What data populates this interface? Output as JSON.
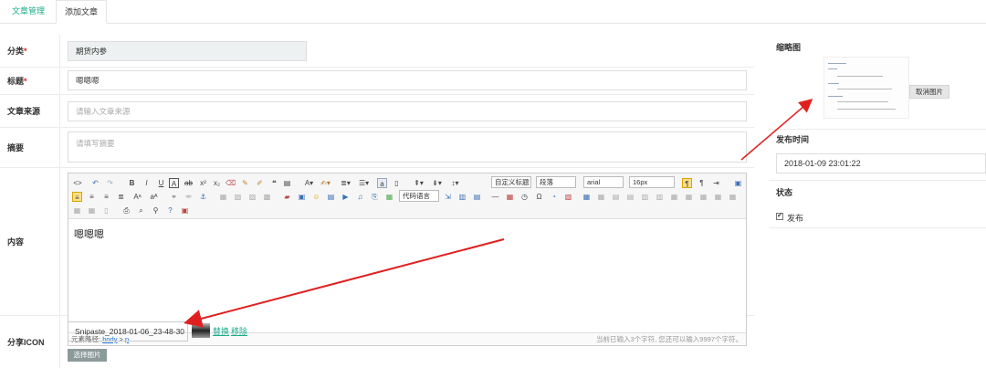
{
  "tabs": [
    {
      "label": "文章管理"
    },
    {
      "label": "添加文章"
    }
  ],
  "form": {
    "category": {
      "label": "分类",
      "required_mark": "*",
      "value": "期货内参"
    },
    "title": {
      "label": "标题",
      "required_mark": "*",
      "value": "嗯嗯嗯"
    },
    "source": {
      "label": "文章来源",
      "placeholder": "请输入文章来源"
    },
    "summary": {
      "label": "摘要",
      "placeholder": "请填写摘要"
    },
    "content": {
      "label": "内容",
      "body_text": "嗯嗯嗯",
      "toolbar": {
        "custom_title_select": "自定义标题",
        "paragraph_select": "段落",
        "font_select": "arial",
        "size_select": "16px",
        "code_lang_select": "代码语言"
      },
      "path_label": "元素路径:",
      "path_body": "body",
      "path_sep": ">",
      "path_p": "p",
      "word_count": "当前已输入3个字符, 您还可以输入9997个字符。"
    },
    "share_icon": {
      "label": "分享ICON",
      "file_value": "Snipaste_2018-01-06_23-48-30",
      "replace_link": "替换",
      "remove_link": "移除",
      "pick_button": "选择图片"
    }
  },
  "sidebar": {
    "thumbnail": {
      "label": "缩略图",
      "cancel_button": "取消图片"
    },
    "publish_time": {
      "label": "发布时间",
      "value": "2018-01-09 23:01:22"
    },
    "status": {
      "label": "状态",
      "checkbox_label": "发布",
      "checked": true
    }
  },
  "colors": {
    "accent": "#1aab8a",
    "arrow": "#e02020"
  }
}
